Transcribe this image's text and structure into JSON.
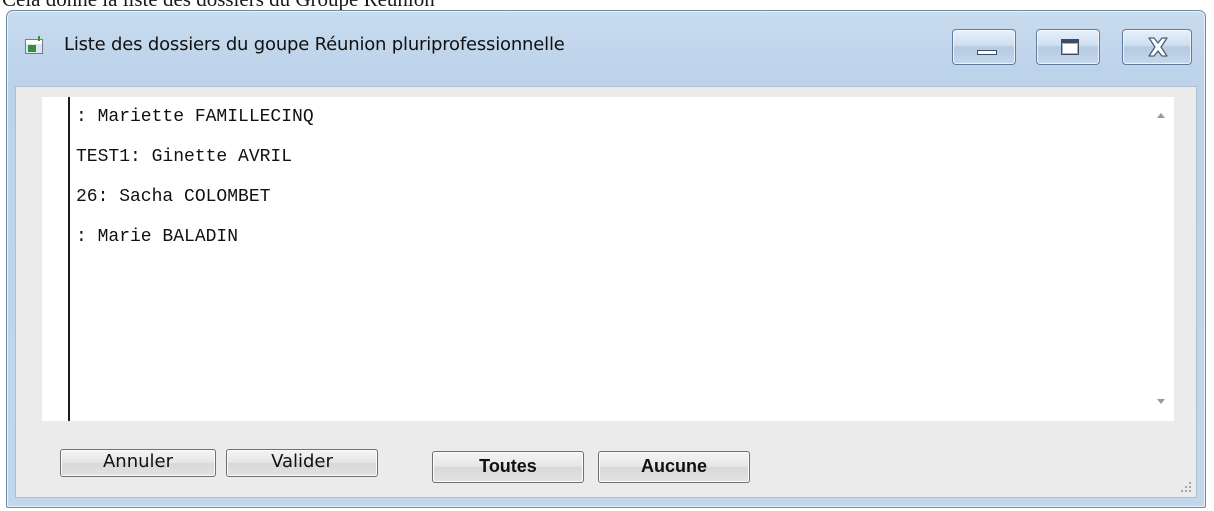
{
  "window": {
    "title": "Liste des dossiers du goupe Réunion pluriprofessionnelle",
    "icon": "app-window-icon",
    "controls": [
      "minimize-icon",
      "maximize-icon",
      "close-icon"
    ]
  },
  "dossiers": [
    ": Mariette FAMILLECINQ",
    "TEST1: Ginette AVRIL",
    "26: Sacha COLOMBET",
    ": Marie BALADIN"
  ],
  "buttons": {
    "annuler": "Annuler",
    "valider": "Valider",
    "toutes": "Toutes",
    "aucune": "Aucune"
  },
  "colors": {
    "frame": "#bfd4ea",
    "client_background": "#ebebeb",
    "list_background": "#ffffff"
  }
}
